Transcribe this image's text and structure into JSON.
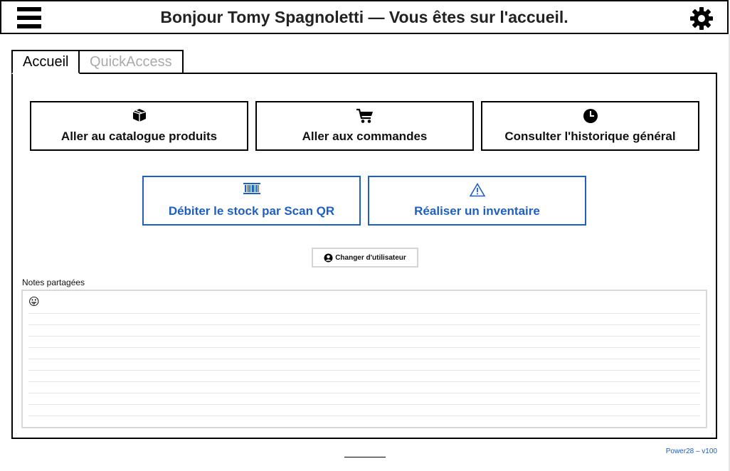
{
  "header": {
    "title": "Bonjour Tomy Spagnoletti — Vous êtes sur l'accueil.",
    "menu_icon": "hamburger-menu-icon",
    "settings_icon": "gear-icon"
  },
  "tabs": [
    {
      "label": "Accueil",
      "active": true
    },
    {
      "label": "QuickAccess",
      "active": false
    }
  ],
  "actions": {
    "row1": [
      {
        "label": "Aller au catalogue produits",
        "icon": "package-box-icon"
      },
      {
        "label": "Aller aux commandes",
        "icon": "shopping-cart-icon"
      },
      {
        "label": "Consulter l'historique général",
        "icon": "clock-icon"
      }
    ],
    "row2": [
      {
        "label": "Débiter le stock par Scan QR",
        "icon": "barcode-icon"
      },
      {
        "label": "Réaliser un inventaire",
        "icon": "warning-triangle-icon"
      }
    ]
  },
  "switch_user": {
    "label": "Changer d'utilisateur",
    "icon": "user-circle-icon"
  },
  "notes": {
    "label": "Notes partagées",
    "value": "😛"
  },
  "footer": {
    "version": "Power28 – v100"
  },
  "colors": {
    "accent_blue": "#1f5fbf",
    "border": "#000000",
    "muted_tab": "#aaaaaa"
  }
}
